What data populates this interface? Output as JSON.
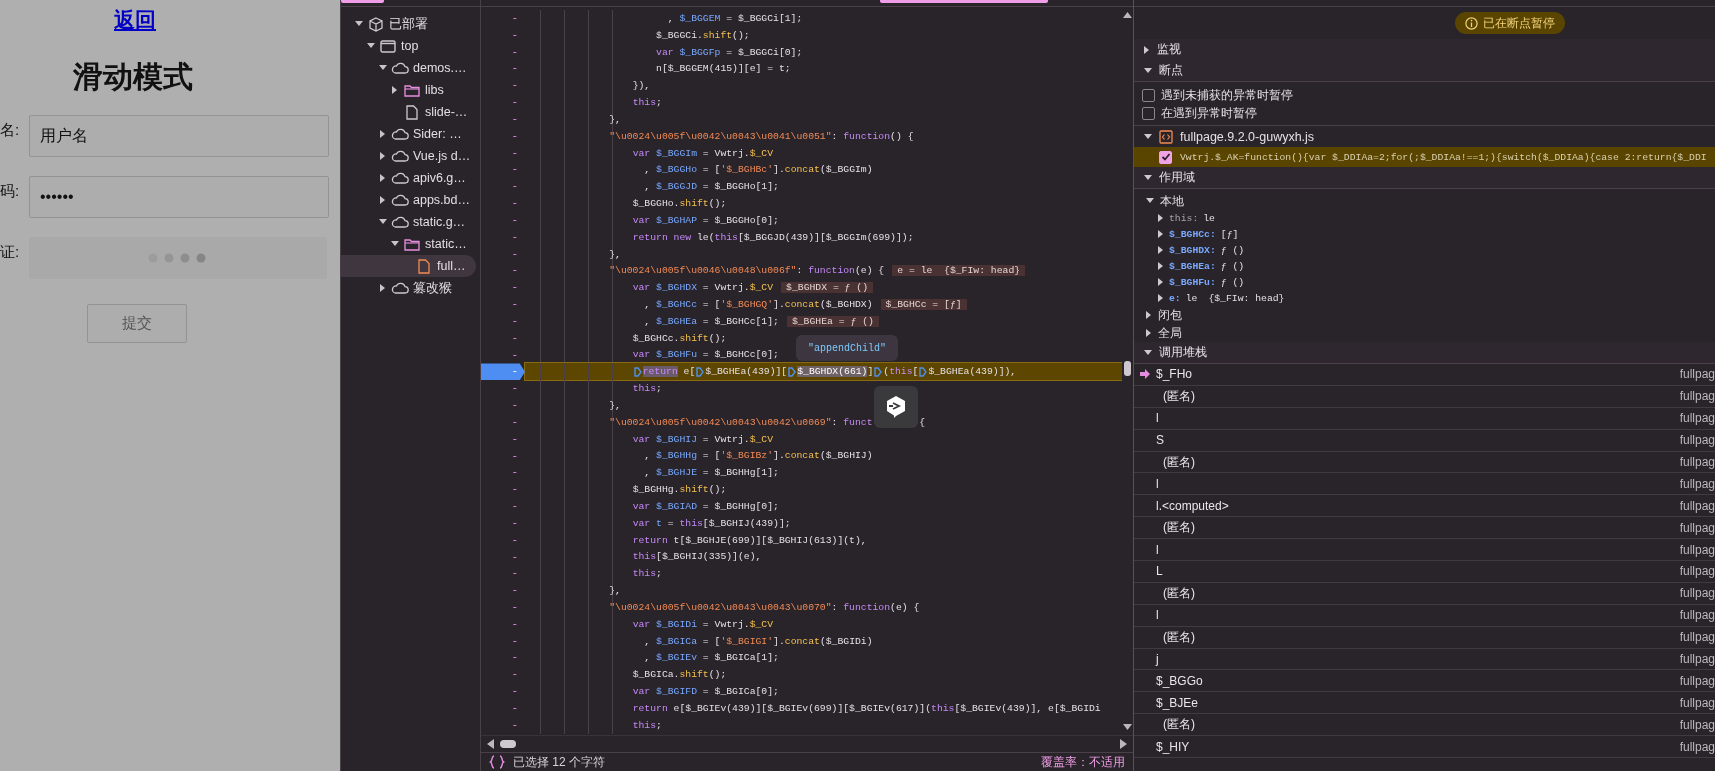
{
  "page": {
    "back_link": "返回",
    "title": "滑动模式",
    "fields": [
      {
        "label": "名:",
        "kind": "text",
        "value": "用户名"
      },
      {
        "label": "码:",
        "kind": "text",
        "value": "••••••"
      },
      {
        "label": "证:",
        "kind": "captcha"
      }
    ],
    "submit": "提交"
  },
  "navigator": {
    "tree": [
      {
        "label": "已部署",
        "kind": "deployed",
        "expanded": true,
        "selected": false,
        "children": [
          {
            "label": "top",
            "kind": "frame",
            "expanded": true,
            "selected": false,
            "children": [
              {
                "label": "demos.…",
                "kind": "origin",
                "expanded": true,
                "selected": false,
                "children": [
                  {
                    "label": "libs",
                    "kind": "folder",
                    "expanded": false,
                    "selected": false
                  },
                  {
                    "label": "slide-…",
                    "kind": "file",
                    "selected": false
                  }
                ]
              },
              {
                "label": "Sider: …",
                "kind": "origin",
                "expanded": false,
                "selected": false
              },
              {
                "label": "Vue.js d…",
                "kind": "origin",
                "expanded": false,
                "selected": false
              },
              {
                "label": "apiv6.g…",
                "kind": "origin",
                "expanded": false,
                "selected": false
              },
              {
                "label": "apps.bd…",
                "kind": "origin",
                "expanded": false,
                "selected": false
              },
              {
                "label": "static.g…",
                "kind": "origin",
                "expanded": true,
                "selected": false,
                "children": [
                  {
                    "label": "static…",
                    "kind": "folder",
                    "expanded": true,
                    "selected": false,
                    "children": [
                      {
                        "label": "full…",
                        "kind": "script",
                        "selected": true
                      }
                    ]
                  }
                ]
              },
              {
                "label": "篡改猴",
                "kind": "origin",
                "expanded": false,
                "selected": false
              }
            ]
          }
        ]
      }
    ]
  },
  "editor": {
    "lines": [
      {
        "gutter": "-",
        "current": false,
        "tokens": [
          {
            "kind": "p",
            "text": "                      , "
          },
          {
            "kind": "v",
            "text": "$_BGGEM"
          },
          {
            "kind": "p",
            "text": " = $_BGGCi[1];"
          }
        ]
      },
      {
        "gutter": "-",
        "current": false,
        "tokens": [
          {
            "kind": "p",
            "text": "                    $_BGGCi."
          },
          {
            "kind": "m",
            "text": "shift"
          },
          {
            "kind": "p",
            "text": "();"
          }
        ]
      },
      {
        "gutter": "-",
        "current": false,
        "tokens": [
          {
            "kind": "k",
            "text": "                    var "
          },
          {
            "kind": "v",
            "text": "$_BGGFp"
          },
          {
            "kind": "p",
            "text": " = $_BGGCi[0];"
          }
        ]
      },
      {
        "gutter": "-",
        "current": false,
        "tokens": [
          {
            "kind": "p",
            "text": "                    n[$_BGGEM(415)][e] = t;"
          }
        ]
      },
      {
        "gutter": "-",
        "current": false,
        "tokens": [
          {
            "kind": "p",
            "text": "                }),"
          }
        ]
      },
      {
        "gutter": "-",
        "current": false,
        "tokens": [
          {
            "kind": "k",
            "text": "                this"
          },
          {
            "kind": "p",
            "text": ";"
          }
        ]
      },
      {
        "gutter": "-",
        "current": false,
        "tokens": [
          {
            "kind": "p",
            "text": "            },"
          }
        ]
      },
      {
        "gutter": "-",
        "current": false,
        "tokens": [
          {
            "kind": "s",
            "text": "            \"\\u0024\\u005f\\u0042\\u0043\\u0041\\u0051\""
          },
          {
            "kind": "p",
            "text": ": "
          },
          {
            "kind": "k",
            "text": "function"
          },
          {
            "kind": "p",
            "text": "() {"
          }
        ]
      },
      {
        "gutter": "-",
        "current": false,
        "tokens": [
          {
            "kind": "k",
            "text": "                var "
          },
          {
            "kind": "v",
            "text": "$_BGGIm"
          },
          {
            "kind": "p",
            "text": " = Vwtrj."
          },
          {
            "kind": "m",
            "text": "$_CV"
          }
        ]
      },
      {
        "gutter": "-",
        "current": false,
        "tokens": [
          {
            "kind": "p",
            "text": "                  , "
          },
          {
            "kind": "v",
            "text": "$_BGGHo"
          },
          {
            "kind": "p",
            "text": " = ["
          },
          {
            "kind": "s",
            "text": "'$_BGHBc'"
          },
          {
            "kind": "p",
            "text": "]."
          },
          {
            "kind": "m",
            "text": "concat"
          },
          {
            "kind": "p",
            "text": "($_BGGIm)"
          }
        ]
      },
      {
        "gutter": "-",
        "current": false,
        "tokens": [
          {
            "kind": "p",
            "text": "                  , "
          },
          {
            "kind": "v",
            "text": "$_BGGJD"
          },
          {
            "kind": "p",
            "text": " = $_BGGHo[1];"
          }
        ]
      },
      {
        "gutter": "-",
        "current": false,
        "tokens": [
          {
            "kind": "p",
            "text": "                $_BGGHo."
          },
          {
            "kind": "m",
            "text": "shift"
          },
          {
            "kind": "p",
            "text": "();"
          }
        ]
      },
      {
        "gutter": "-",
        "current": false,
        "tokens": [
          {
            "kind": "k",
            "text": "                var "
          },
          {
            "kind": "v",
            "text": "$_BGHAP"
          },
          {
            "kind": "p",
            "text": " = $_BGGHo[0];"
          }
        ]
      },
      {
        "gutter": "-",
        "current": false,
        "tokens": [
          {
            "kind": "k",
            "text": "                return new "
          },
          {
            "kind": "p",
            "text": "le("
          },
          {
            "kind": "k",
            "text": "this"
          },
          {
            "kind": "p",
            "text": "[$_BGGJD(439)][$_BGGIm(699)]);"
          }
        ]
      },
      {
        "gutter": "-",
        "current": false,
        "tokens": [
          {
            "kind": "p",
            "text": "            },"
          }
        ]
      },
      {
        "gutter": "-",
        "current": false,
        "tokens": [
          {
            "kind": "s",
            "text": "            \"\\u0024\\u005f\\u0046\\u0048\\u006f\""
          },
          {
            "kind": "p",
            "text": ": "
          },
          {
            "kind": "k",
            "text": "function"
          },
          {
            "kind": "p",
            "text": "(e) {"
          }
        ],
        "inline_value": "e = le  {$_FIw: head}"
      },
      {
        "gutter": "-",
        "current": false,
        "tokens": [
          {
            "kind": "k",
            "text": "                var "
          },
          {
            "kind": "v",
            "text": "$_BGHDX"
          },
          {
            "kind": "p",
            "text": " = Vwtrj."
          },
          {
            "kind": "m",
            "text": "$_CV"
          }
        ],
        "inline_value": "$_BGHDX = ƒ ()"
      },
      {
        "gutter": "-",
        "current": false,
        "tokens": [
          {
            "kind": "p",
            "text": "                  , "
          },
          {
            "kind": "v",
            "text": "$_BGHCc"
          },
          {
            "kind": "p",
            "text": " = ["
          },
          {
            "kind": "s",
            "text": "'$_BGHGQ'"
          },
          {
            "kind": "p",
            "text": "]."
          },
          {
            "kind": "m",
            "text": "concat"
          },
          {
            "kind": "p",
            "text": "($_BGHDX)"
          }
        ],
        "inline_value": "$_BGHCc = [ƒ]"
      },
      {
        "gutter": "-",
        "current": false,
        "tokens": [
          {
            "kind": "p",
            "text": "                  , "
          },
          {
            "kind": "v",
            "text": "$_BGHEa"
          },
          {
            "kind": "p",
            "text": " = $_BGHCc[1];"
          }
        ],
        "inline_value": "$_BGHEa = ƒ ()"
      },
      {
        "gutter": "-",
        "current": false,
        "tokens": [
          {
            "kind": "p",
            "text": "                $_BGHCc."
          },
          {
            "kind": "m",
            "text": "shift"
          },
          {
            "kind": "p",
            "text": "();"
          }
        ]
      },
      {
        "gutter": "-",
        "current": false,
        "tokens": [
          {
            "kind": "k",
            "text": "                var "
          },
          {
            "kind": "v",
            "text": "$_BGHFu"
          },
          {
            "kind": "p",
            "text": " = $_BGHCc[0];"
          }
        ]
      },
      {
        "gutter": "-",
        "current": true,
        "tokens": [
          {
            "kind": "marker"
          },
          {
            "kind": "x",
            "text": "return"
          },
          {
            "kind": "p",
            "text": " e["
          },
          {
            "kind": "marker"
          },
          {
            "kind": "p",
            "text": "$_BGHEa(439)]["
          },
          {
            "kind": "marker"
          },
          {
            "kind": "sel",
            "text": "$_BGHDX(661)"
          },
          {
            "kind": "p",
            "text": "]"
          },
          {
            "kind": "marker"
          },
          {
            "kind": "p",
            "text": "("
          },
          {
            "kind": "k",
            "text": "this"
          },
          {
            "kind": "p",
            "text": "["
          },
          {
            "kind": "marker"
          },
          {
            "kind": "p",
            "text": "$_BGHEa(439)]),"
          }
        ]
      },
      {
        "gutter": "-",
        "current": false,
        "tokens": [
          {
            "kind": "k",
            "text": "                this"
          },
          {
            "kind": "p",
            "text": ";"
          }
        ]
      },
      {
        "gutter": "-",
        "current": false,
        "tokens": [
          {
            "kind": "p",
            "text": "            },"
          }
        ]
      },
      {
        "gutter": "-",
        "current": false,
        "tokens": [
          {
            "kind": "s",
            "text": "            \"\\u0024\\u005f\\u0042\\u0043\\u0042\\u0069\""
          },
          {
            "kind": "p",
            "text": ": "
          },
          {
            "kind": "k",
            "text": "funct"
          },
          {
            "kind": "p",
            "text": "        {"
          }
        ]
      },
      {
        "gutter": "-",
        "current": false,
        "tokens": [
          {
            "kind": "k",
            "text": "                var "
          },
          {
            "kind": "v",
            "text": "$_BGHIJ"
          },
          {
            "kind": "p",
            "text": " = Vwtrj."
          },
          {
            "kind": "m",
            "text": "$_CV"
          }
        ]
      },
      {
        "gutter": "-",
        "current": false,
        "tokens": [
          {
            "kind": "p",
            "text": "                  , "
          },
          {
            "kind": "v",
            "text": "$_BGHHg"
          },
          {
            "kind": "p",
            "text": " = ["
          },
          {
            "kind": "s",
            "text": "'$_BGIBz'"
          },
          {
            "kind": "p",
            "text": "]."
          },
          {
            "kind": "m",
            "text": "concat"
          },
          {
            "kind": "p",
            "text": "($_BGHIJ)"
          }
        ]
      },
      {
        "gutter": "-",
        "current": false,
        "tokens": [
          {
            "kind": "p",
            "text": "                  , "
          },
          {
            "kind": "v",
            "text": "$_BGHJE"
          },
          {
            "kind": "p",
            "text": " = $_BGHHg[1];"
          }
        ]
      },
      {
        "gutter": "-",
        "current": false,
        "tokens": [
          {
            "kind": "p",
            "text": "                $_BGHHg."
          },
          {
            "kind": "m",
            "text": "shift"
          },
          {
            "kind": "p",
            "text": "();"
          }
        ]
      },
      {
        "gutter": "-",
        "current": false,
        "tokens": [
          {
            "kind": "k",
            "text": "                var "
          },
          {
            "kind": "v",
            "text": "$_BGIAD"
          },
          {
            "kind": "p",
            "text": " = $_BGHHg[0];"
          }
        ]
      },
      {
        "gutter": "-",
        "current": false,
        "tokens": [
          {
            "kind": "k",
            "text": "                var "
          },
          {
            "kind": "v",
            "text": "t"
          },
          {
            "kind": "p",
            "text": " = "
          },
          {
            "kind": "k",
            "text": "this"
          },
          {
            "kind": "p",
            "text": "[$_BGHIJ(439)];"
          }
        ]
      },
      {
        "gutter": "-",
        "current": false,
        "tokens": [
          {
            "kind": "k",
            "text": "                return"
          },
          {
            "kind": "p",
            "text": " t[$_BGHJE(699)][$_BGHIJ(613)](t),"
          }
        ]
      },
      {
        "gutter": "-",
        "current": false,
        "tokens": [
          {
            "kind": "k",
            "text": "                this"
          },
          {
            "kind": "p",
            "text": "[$_BGHIJ(335)](e),"
          }
        ]
      },
      {
        "gutter": "-",
        "current": false,
        "tokens": [
          {
            "kind": "k",
            "text": "                this"
          },
          {
            "kind": "p",
            "text": ";"
          }
        ]
      },
      {
        "gutter": "-",
        "current": false,
        "tokens": [
          {
            "kind": "p",
            "text": "            },"
          }
        ]
      },
      {
        "gutter": "-",
        "current": false,
        "tokens": [
          {
            "kind": "s",
            "text": "            \"\\u0024\\u005f\\u0042\\u0043\\u0043\\u0070\""
          },
          {
            "kind": "p",
            "text": ": "
          },
          {
            "kind": "k",
            "text": "function"
          },
          {
            "kind": "p",
            "text": "(e) {"
          }
        ]
      },
      {
        "gutter": "-",
        "current": false,
        "tokens": [
          {
            "kind": "k",
            "text": "                var "
          },
          {
            "kind": "v",
            "text": "$_BGIDi"
          },
          {
            "kind": "p",
            "text": " = Vwtrj."
          },
          {
            "kind": "m",
            "text": "$_CV"
          }
        ]
      },
      {
        "gutter": "-",
        "current": false,
        "tokens": [
          {
            "kind": "p",
            "text": "                  , "
          },
          {
            "kind": "v",
            "text": "$_BGICa"
          },
          {
            "kind": "p",
            "text": " = ["
          },
          {
            "kind": "s",
            "text": "'$_BGIGI'"
          },
          {
            "kind": "p",
            "text": "]."
          },
          {
            "kind": "m",
            "text": "concat"
          },
          {
            "kind": "p",
            "text": "($_BGIDi)"
          }
        ]
      },
      {
        "gutter": "-",
        "current": false,
        "tokens": [
          {
            "kind": "p",
            "text": "                  , "
          },
          {
            "kind": "v",
            "text": "$_BGIEv"
          },
          {
            "kind": "p",
            "text": " = $_BGICa[1];"
          }
        ]
      },
      {
        "gutter": "-",
        "current": false,
        "tokens": [
          {
            "kind": "p",
            "text": "                $_BGICa."
          },
          {
            "kind": "m",
            "text": "shift"
          },
          {
            "kind": "p",
            "text": "();"
          }
        ]
      },
      {
        "gutter": "-",
        "current": false,
        "tokens": [
          {
            "kind": "k",
            "text": "                var "
          },
          {
            "kind": "v",
            "text": "$_BGIFD"
          },
          {
            "kind": "p",
            "text": " = $_BGICa[0];"
          }
        ]
      },
      {
        "gutter": "-",
        "current": false,
        "tokens": [
          {
            "kind": "k",
            "text": "                return"
          },
          {
            "kind": "p",
            "text": " e[$_BGIEv(439)][$_BGIEv(699)][$_BGIEv(617)]("
          },
          {
            "kind": "k",
            "text": "this"
          },
          {
            "kind": "p",
            "text": "[$_BGIEv(439)], e[$_BGIDi"
          }
        ]
      },
      {
        "gutter": "-",
        "current": false,
        "tokens": [
          {
            "kind": "k",
            "text": "                this"
          },
          {
            "kind": "p",
            "text": ";"
          }
        ]
      }
    ],
    "hover_tooltip": "\"appendChild\"",
    "status": {
      "selection": "已选择 12 个字符",
      "coverage": "覆盖率：不适用"
    }
  },
  "debugger": {
    "paused_banner": "已在断点暂停",
    "watch": {
      "title": "监视",
      "expanded": false
    },
    "breakpoints": {
      "title": "断点",
      "expanded": true,
      "options": [
        {
          "label": "遇到未捕获的异常时暂停",
          "checked": false
        },
        {
          "label": "在遇到异常时暂停",
          "checked": false
        }
      ],
      "files": [
        {
          "name": "fullpage.9.2.0-guwyxh.js",
          "expanded": true,
          "items": [
            {
              "code": "Vwtrj.$_AK=function(){var $_DDIAa=2;for(;$_DDIAa!==1;){switch($_DDIAa){case 2:return{$_DDI",
              "checked": true
            }
          ]
        }
      ]
    },
    "scope": {
      "title": "作用域",
      "expanded": true,
      "groups": [
        {
          "title": "本地",
          "expanded": true,
          "vars": [
            {
              "name": "this:",
              "kind": "receiver",
              "value": "le",
              "expanded": false
            },
            {
              "name": "$_BGHCc:",
              "kind": "local",
              "value": "[ƒ]",
              "expanded": false
            },
            {
              "name": "$_BGHDX:",
              "kind": "local",
              "value": "ƒ ()",
              "expanded": false
            },
            {
              "name": "$_BGHEa:",
              "kind": "local",
              "value": "ƒ ()",
              "expanded": false
            },
            {
              "name": "$_BGHFu:",
              "kind": "local",
              "value": "ƒ ()",
              "expanded": false
            },
            {
              "name": "e:",
              "kind": "local",
              "value": "le",
              "preview": "{$_FIw: head}",
              "expanded": false
            }
          ]
        },
        {
          "title": "闭包",
          "expanded": false
        },
        {
          "title": "全局",
          "expanded": false
        }
      ]
    },
    "call_stack": {
      "title": "调用堆栈",
      "expanded": true,
      "frames": [
        {
          "name": "$_FHo",
          "kind": "named",
          "location": "fullpag",
          "current": true
        },
        {
          "name": "(匿名)",
          "kind": "anonymous",
          "location": "fullpag",
          "current": false
        },
        {
          "name": "l",
          "kind": "named",
          "location": "fullpag",
          "current": false
        },
        {
          "name": "S",
          "kind": "named",
          "location": "fullpag",
          "current": false
        },
        {
          "name": "(匿名)",
          "kind": "anonymous",
          "location": "fullpag",
          "current": false
        },
        {
          "name": "l",
          "kind": "named",
          "location": "fullpag",
          "current": false
        },
        {
          "name": "l.<computed>",
          "kind": "named",
          "location": "fullpag",
          "current": false
        },
        {
          "name": "(匿名)",
          "kind": "anonymous",
          "location": "fullpag",
          "current": false
        },
        {
          "name": "l",
          "kind": "named",
          "location": "fullpag",
          "current": false
        },
        {
          "name": "L",
          "kind": "named",
          "location": "fullpag",
          "current": false
        },
        {
          "name": "(匿名)",
          "kind": "anonymous",
          "location": "fullpag",
          "current": false
        },
        {
          "name": "l",
          "kind": "named",
          "location": "fullpag",
          "current": false
        },
        {
          "name": "(匿名)",
          "kind": "anonymous",
          "location": "fullpag",
          "current": false
        },
        {
          "name": "j",
          "kind": "named",
          "location": "fullpag",
          "current": false
        },
        {
          "name": "$_BGGo",
          "kind": "named",
          "location": "fullpag",
          "current": false
        },
        {
          "name": "$_BJEe",
          "kind": "named",
          "location": "fullpag",
          "current": false
        },
        {
          "name": "(匿名)",
          "kind": "anonymous",
          "location": "fullpag",
          "current": false
        },
        {
          "name": "$_HIY",
          "kind": "named",
          "location": "fullpag",
          "current": false
        }
      ]
    }
  }
}
